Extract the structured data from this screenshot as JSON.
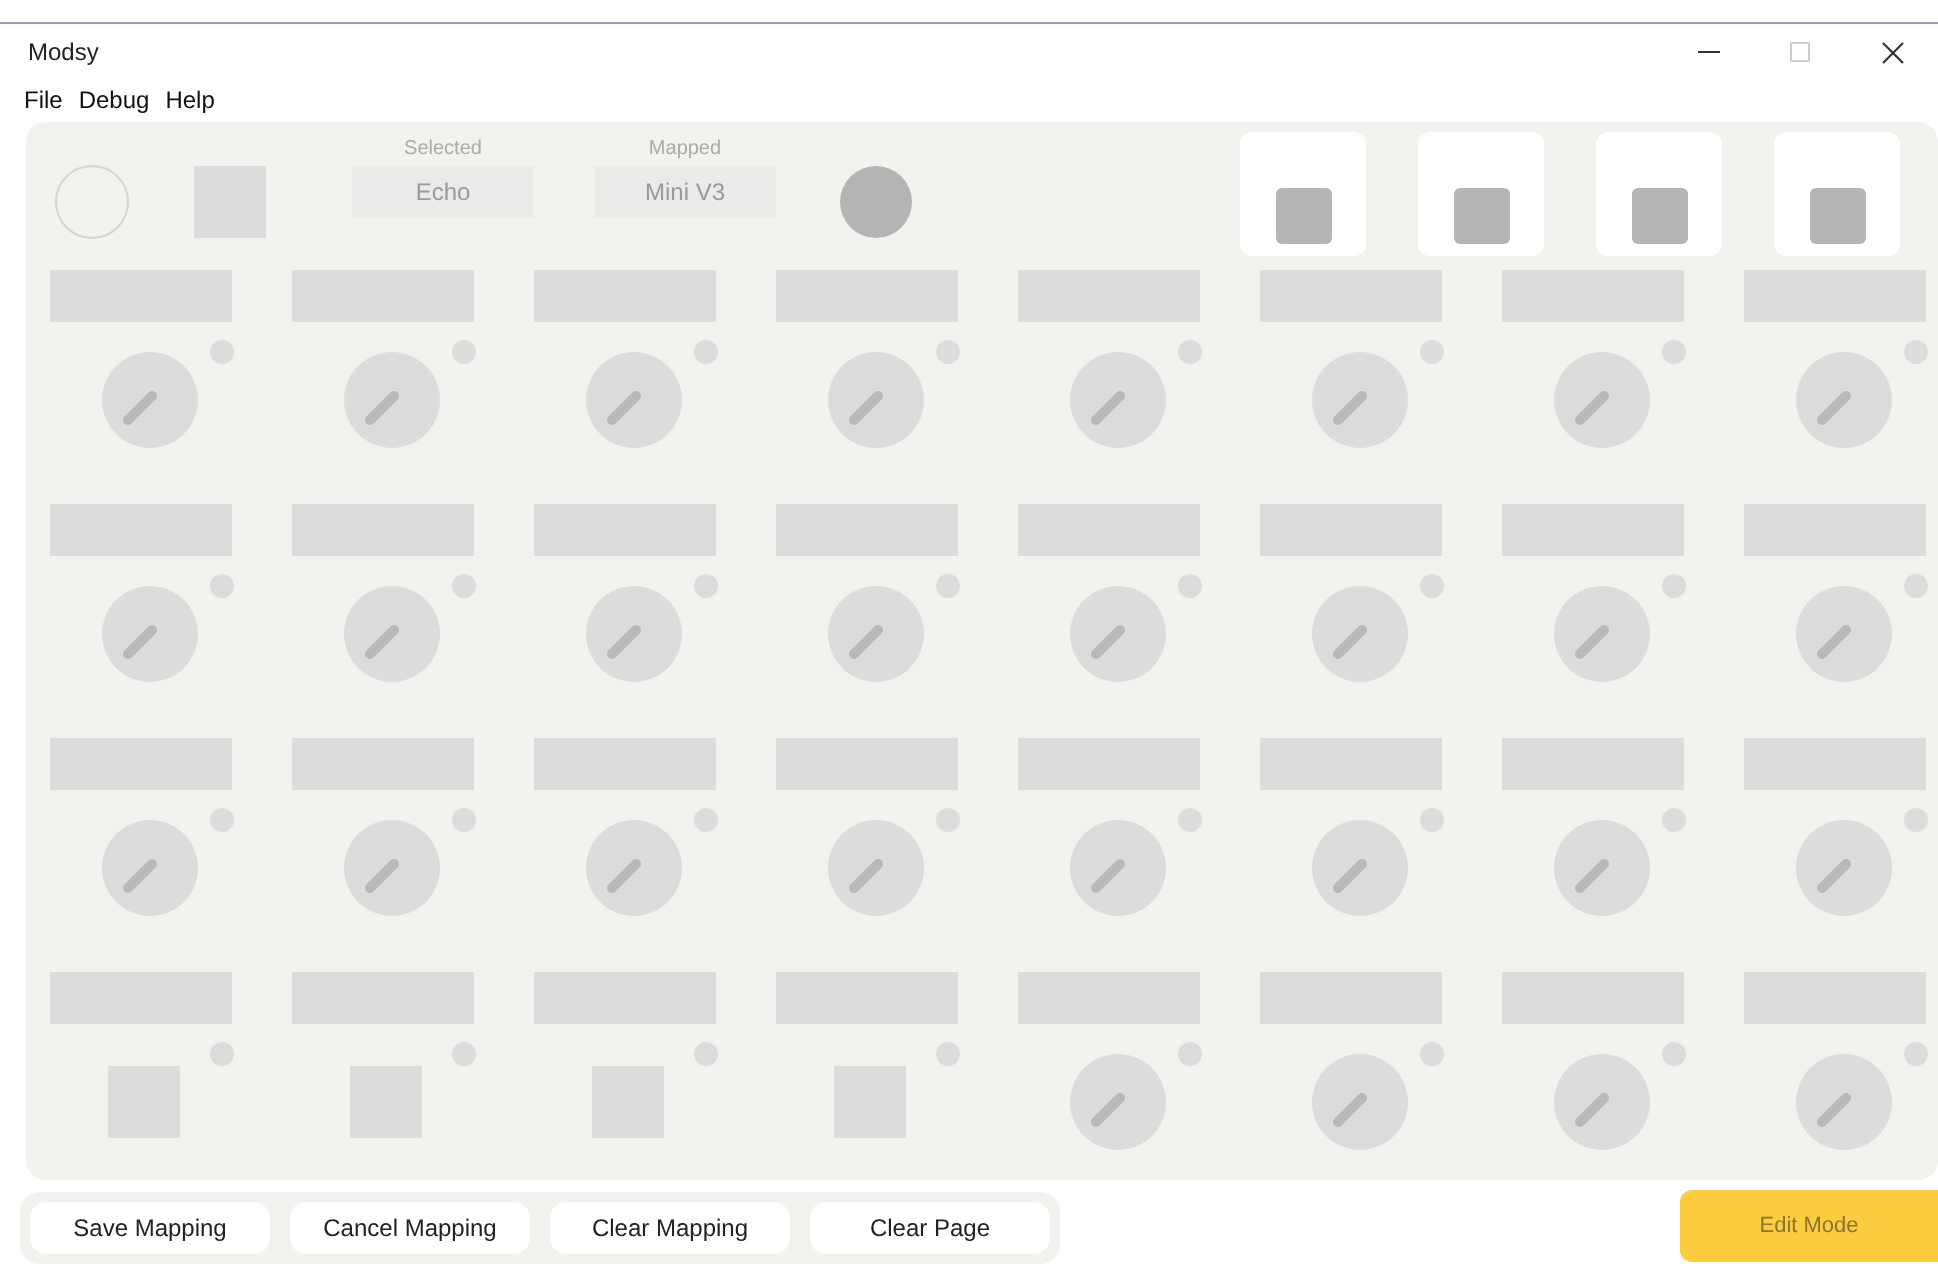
{
  "window": {
    "title": "Modsy"
  },
  "menu": [
    "File",
    "Debug",
    "Help"
  ],
  "header": {
    "selected": {
      "label": "Selected",
      "value": "Echo"
    },
    "mapped": {
      "label": "Mapped",
      "value": "Mini V3"
    }
  },
  "grid": [
    [
      {
        "kind": "knob"
      },
      {
        "kind": "knob"
      },
      {
        "kind": "knob"
      },
      {
        "kind": "knob"
      },
      {
        "kind": "knob"
      },
      {
        "kind": "knob"
      },
      {
        "kind": "knob"
      },
      {
        "kind": "knob"
      }
    ],
    [
      {
        "kind": "knob"
      },
      {
        "kind": "knob"
      },
      {
        "kind": "knob"
      },
      {
        "kind": "knob"
      },
      {
        "kind": "knob"
      },
      {
        "kind": "knob"
      },
      {
        "kind": "knob"
      },
      {
        "kind": "knob"
      }
    ],
    [
      {
        "kind": "knob"
      },
      {
        "kind": "knob"
      },
      {
        "kind": "knob"
      },
      {
        "kind": "knob"
      },
      {
        "kind": "knob"
      },
      {
        "kind": "knob"
      },
      {
        "kind": "knob"
      },
      {
        "kind": "knob"
      }
    ],
    [
      {
        "kind": "pad"
      },
      {
        "kind": "pad"
      },
      {
        "kind": "pad"
      },
      {
        "kind": "pad"
      },
      {
        "kind": "knob"
      },
      {
        "kind": "knob"
      },
      {
        "kind": "knob"
      },
      {
        "kind": "knob"
      }
    ]
  ],
  "buttons": [
    "Save Mapping",
    "Cancel Mapping",
    "Clear Mapping",
    "Clear Page"
  ],
  "edit_mode": {
    "label": "Edit Mode",
    "disabled": true
  }
}
